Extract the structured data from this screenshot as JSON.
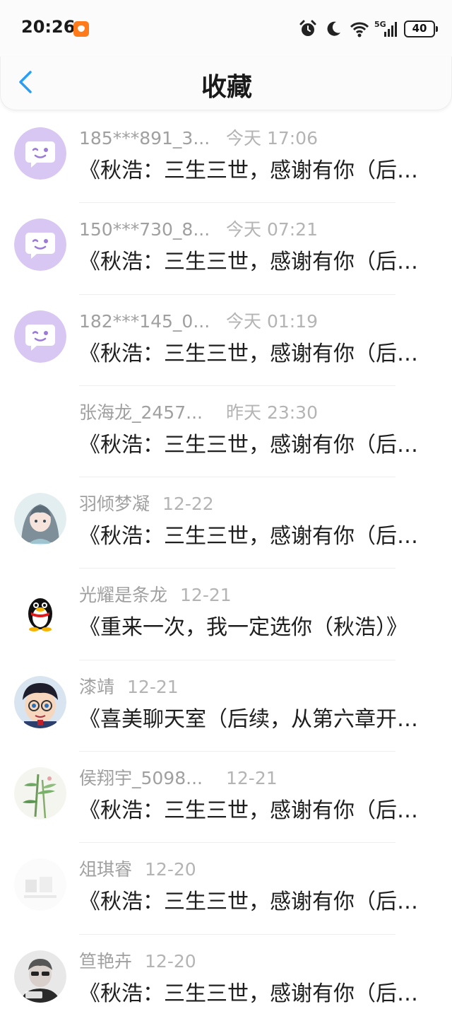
{
  "status_bar": {
    "time": "20:26",
    "signal_type": "5G",
    "battery": "40"
  },
  "header": {
    "title": "收藏",
    "back_icon": "chevron-left-icon",
    "accent": "#2a9df4"
  },
  "items": [
    {
      "name": "185***891_3...",
      "date": "今天 17:06",
      "message": "《秋浩：三生三世，感谢有你（后续...",
      "avatar": "chat-bubble-purple"
    },
    {
      "name": "150***730_8...",
      "date": "今天 07:21",
      "message": "《秋浩：三生三世，感谢有你（后续...",
      "avatar": "chat-bubble-purple"
    },
    {
      "name": "182***145_0...",
      "date": "今天 01:19",
      "message": "《秋浩：三生三世，感谢有你（后续...",
      "avatar": "chat-bubble-purple"
    },
    {
      "name": "张海龙_2457...",
      "date": "昨天 23:30",
      "message": "《秋浩：三生三世，感谢有你（后续...",
      "avatar": "none"
    },
    {
      "name": "羽倾梦凝",
      "date": "12-22",
      "message": "《秋浩：三生三世，感谢有你（后续...",
      "avatar": "anime-girl"
    },
    {
      "name": "光耀是条龙",
      "date": "12-21",
      "message": "《重来一次，我一定选你（秋浩）》",
      "avatar": "penguin"
    },
    {
      "name": "漆靖",
      "date": "12-21",
      "message": "《喜美聊天室（后续，从第六章开始...",
      "avatar": "cartoon-boy"
    },
    {
      "name": "侯翔宇_5098...",
      "date": "12-21",
      "message": "《秋浩：三生三世，感谢有你（后续...",
      "avatar": "bamboo"
    },
    {
      "name": "俎琪睿",
      "date": "12-20",
      "message": "《秋浩：三生三世，感谢有你（后续...",
      "avatar": "faded-photo"
    },
    {
      "name": "笪艳卉",
      "date": "12-20",
      "message": "《秋浩：三生三世，感谢有你（后续...",
      "avatar": "sunglasses-person"
    }
  ]
}
